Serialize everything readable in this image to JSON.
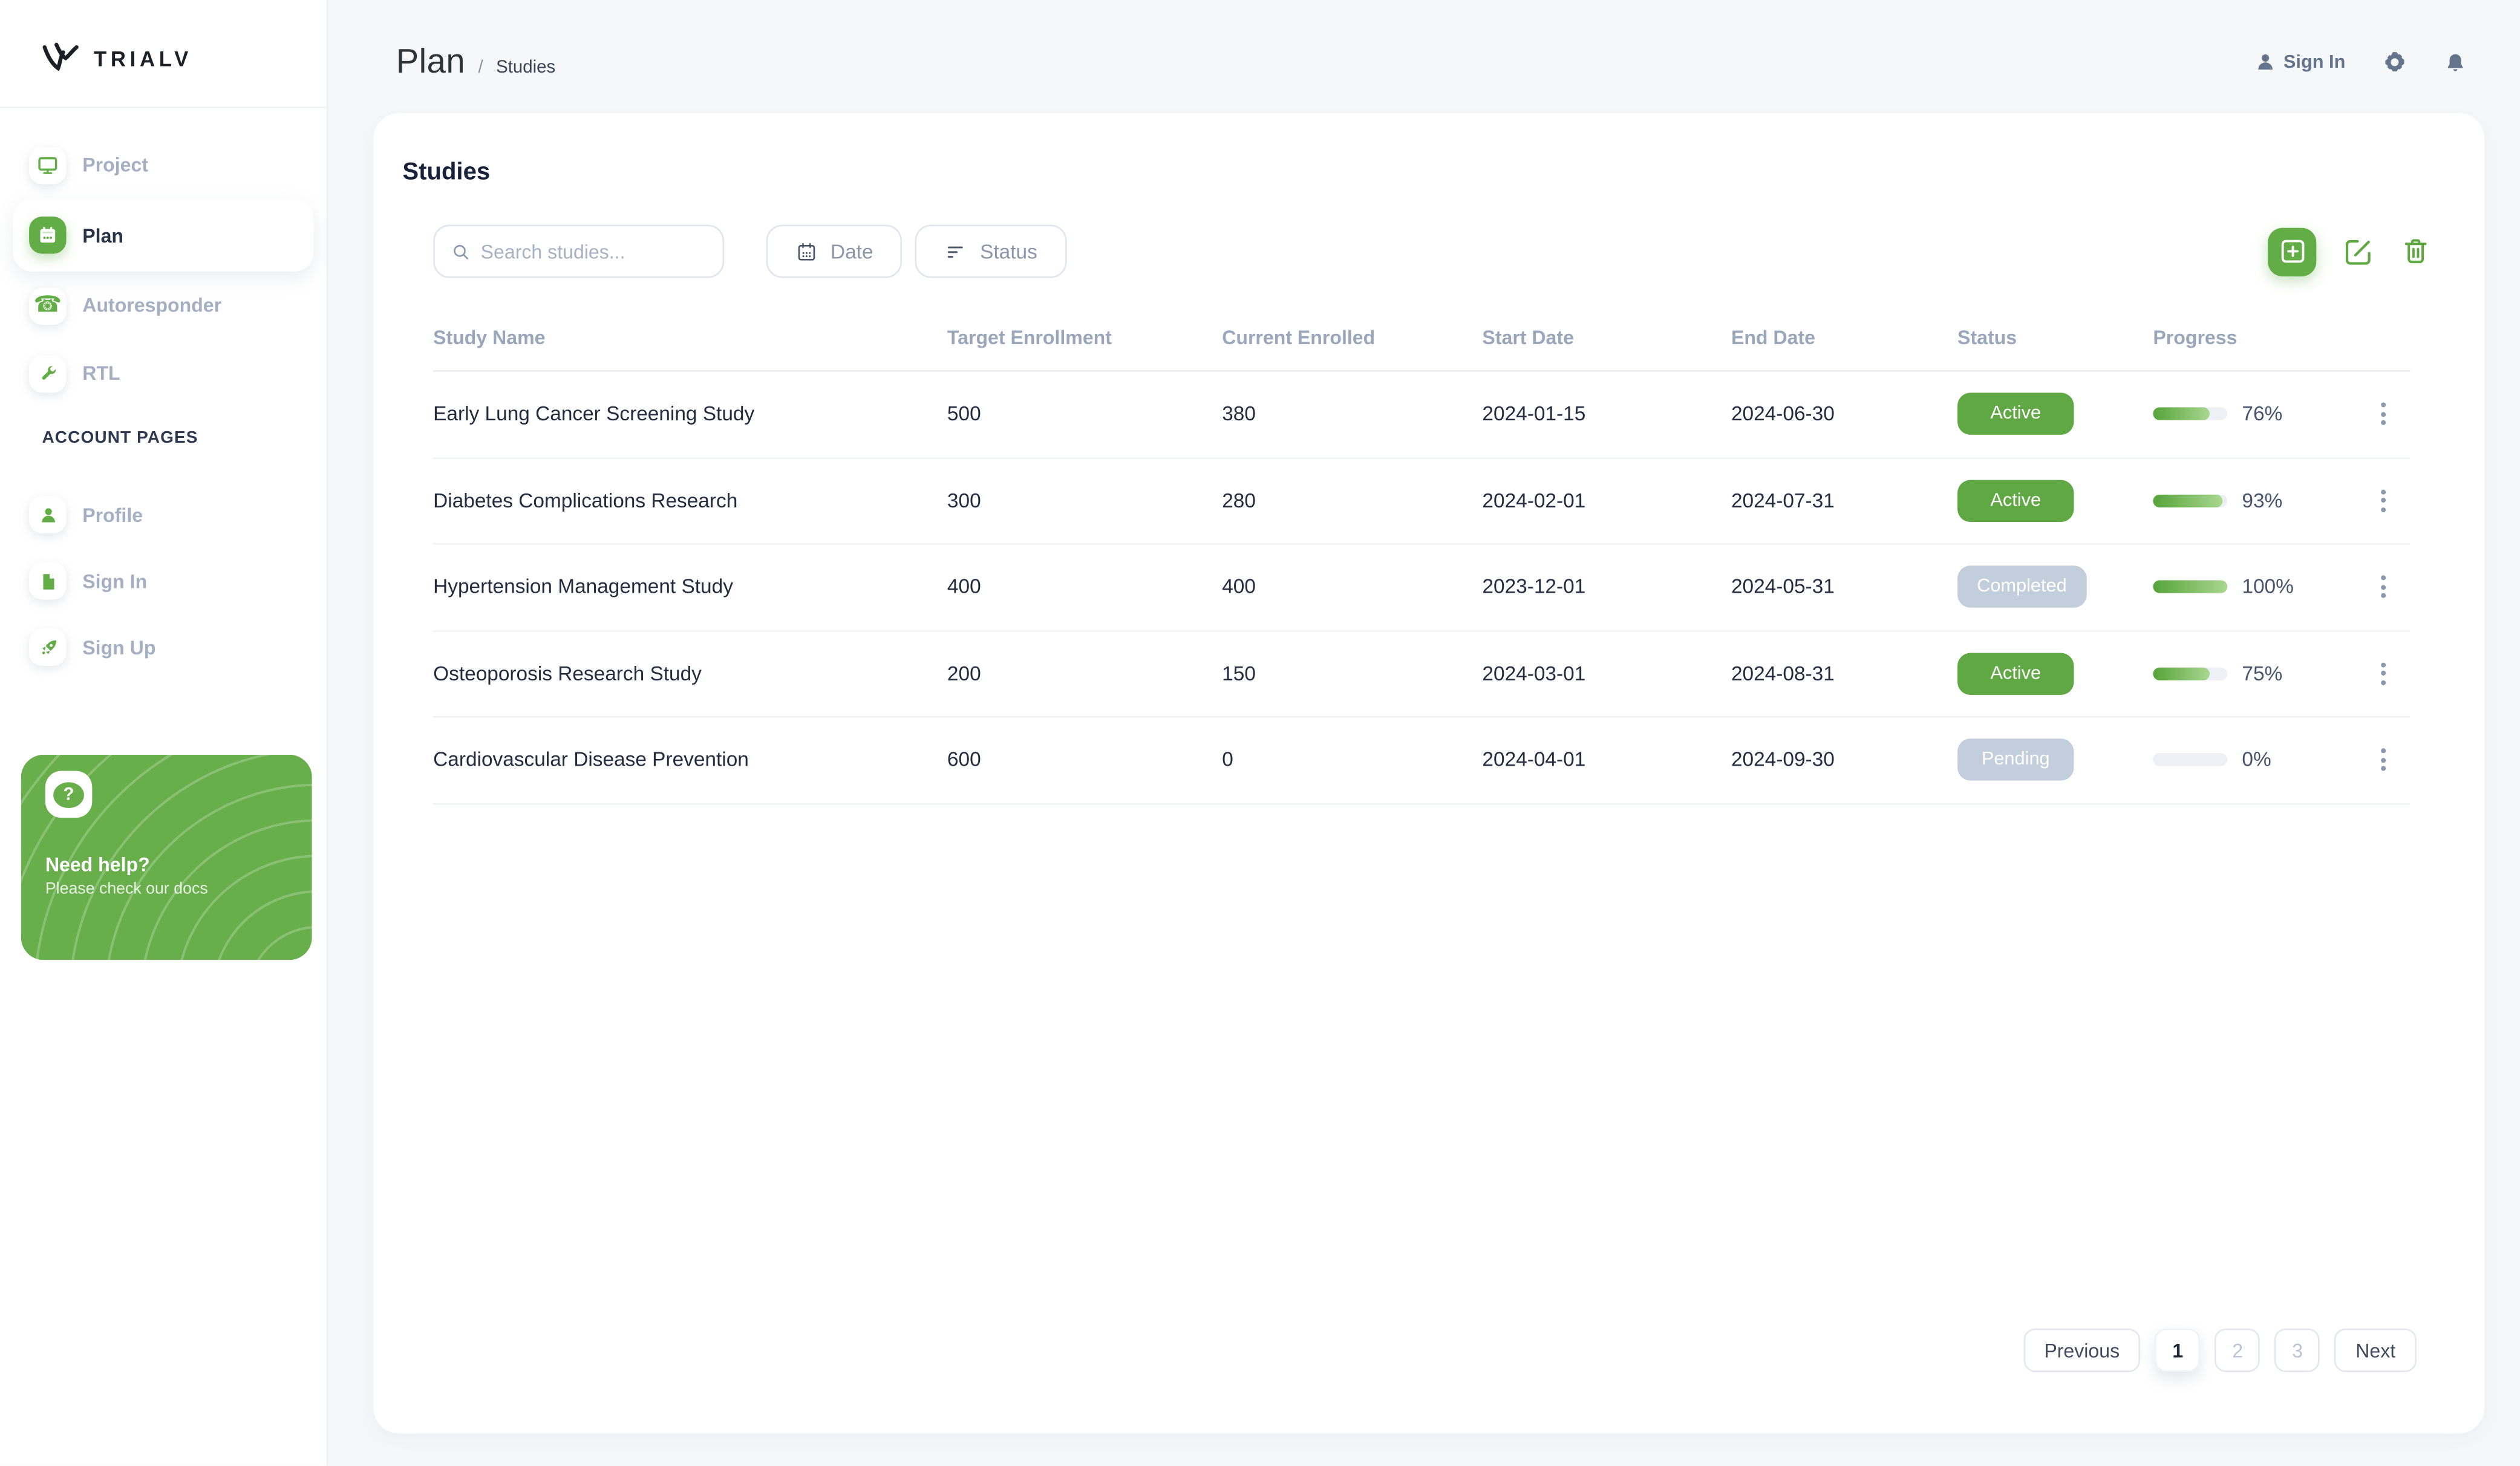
{
  "brand": {
    "name": "TRIALV"
  },
  "topbar": {
    "title": "Plan",
    "separator": "/",
    "breadcrumb": "Studies",
    "sign_in": "Sign In"
  },
  "sidebar": {
    "items": [
      {
        "label": "Project",
        "icon": "monitor-icon",
        "active": false
      },
      {
        "label": "Plan",
        "icon": "calendar-icon",
        "active": true
      },
      {
        "label": "Autoresponder",
        "icon": "phone-icon",
        "active": false
      },
      {
        "label": "RTL",
        "icon": "wrench-icon",
        "active": false
      }
    ],
    "section": "ACCOUNT PAGES",
    "account_items": [
      {
        "label": "Profile",
        "icon": "person-icon"
      },
      {
        "label": "Sign In",
        "icon": "document-icon"
      },
      {
        "label": "Sign Up",
        "icon": "rocket-icon"
      }
    ],
    "help": {
      "title": "Need help?",
      "subtitle": "Please check our docs"
    }
  },
  "studies": {
    "title": "Studies",
    "search_placeholder": "Search studies...",
    "date_label": "Date",
    "status_label": "Status",
    "columns": [
      "Study Name",
      "Target Enrollment",
      "Current Enrolled",
      "Start Date",
      "End Date",
      "Status",
      "Progress"
    ],
    "rows": [
      {
        "name": "Early Lung Cancer Screening Study",
        "target": "500",
        "current": "380",
        "start": "2024-01-15",
        "end": "2024-06-30",
        "status": "Active",
        "progress_pct": 76,
        "progress_label": "76%"
      },
      {
        "name": "Diabetes Complications Research",
        "target": "300",
        "current": "280",
        "start": "2024-02-01",
        "end": "2024-07-31",
        "status": "Active",
        "progress_pct": 93,
        "progress_label": "93%"
      },
      {
        "name": "Hypertension Management Study",
        "target": "400",
        "current": "400",
        "start": "2023-12-01",
        "end": "2024-05-31",
        "status": "Completed",
        "progress_pct": 100,
        "progress_label": "100%"
      },
      {
        "name": "Osteoporosis Research Study",
        "target": "200",
        "current": "150",
        "start": "2024-03-01",
        "end": "2024-08-31",
        "status": "Active",
        "progress_pct": 75,
        "progress_label": "75%"
      },
      {
        "name": "Cardiovascular Disease Prevention",
        "target": "600",
        "current": "0",
        "start": "2024-04-01",
        "end": "2024-09-30",
        "status": "Pending",
        "progress_pct": 0,
        "progress_label": "0%"
      }
    ],
    "pagination": {
      "previous": "Previous",
      "pages": [
        "1",
        "2",
        "3"
      ],
      "active": "1",
      "next": "Next"
    }
  },
  "colors": {
    "brand_green": "#63ad47",
    "badge_green": "#5fa843",
    "badge_gray": "#c3cedd",
    "progress_gradient_start": "#56a339",
    "progress_gradient_end": "#a9d78f",
    "background": "#f6f7f9"
  }
}
